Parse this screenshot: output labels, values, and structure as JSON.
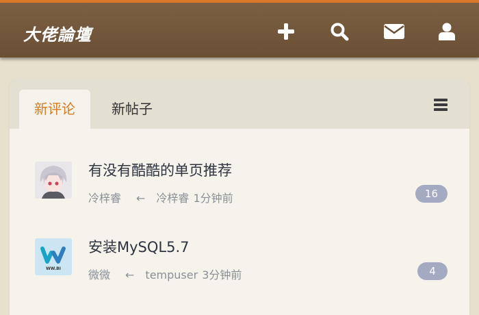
{
  "header": {
    "logo_text": "大佬論壇",
    "icons": [
      "plus-icon",
      "search-icon",
      "envelope-icon",
      "user-icon"
    ],
    "accent_color": "#d9772a",
    "bar_color": "#6a4f35"
  },
  "tabs": [
    {
      "label": "新评论",
      "active": true
    },
    {
      "label": "新帖子",
      "active": false
    }
  ],
  "posts": [
    {
      "title": "有没有酷酷的单页推荐",
      "author": "冷梓睿",
      "arrow": "←",
      "last_replier": "冷梓睿",
      "time": "1分钟前",
      "reply_count": "16",
      "avatar": "anime-avatar"
    },
    {
      "title": "安装MySQL5.7",
      "author": "微微",
      "arrow": "←",
      "last_replier": "tempuser",
      "time": "3分钟前",
      "reply_count": "4",
      "avatar": "w-logo-avatar",
      "avatar_caption": "WW.BI"
    }
  ],
  "colors": {
    "active_tab": "#d97a1d",
    "badge": "#a3aac2"
  }
}
